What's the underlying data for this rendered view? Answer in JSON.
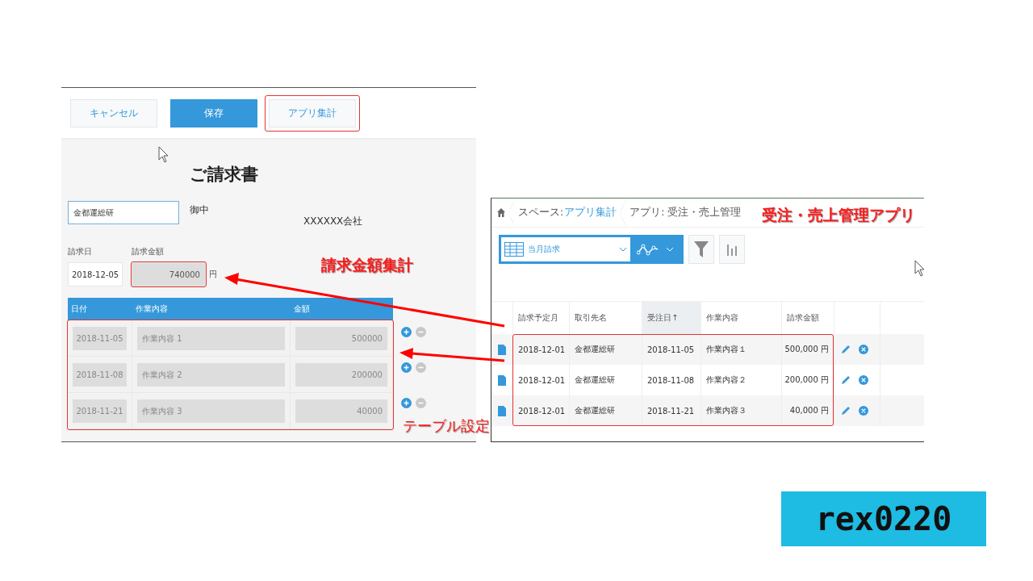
{
  "form_panel": {
    "buttons": [
      {
        "label": "キャンセル",
        "kind": "secondary",
        "highlighted": false
      },
      {
        "label": "保存",
        "kind": "primary",
        "highlighted": false
      },
      {
        "label": "アプリ集計",
        "kind": "secondary",
        "highlighted": true
      }
    ],
    "title": "ご請求書",
    "customer_field": {
      "value": "金都運総研"
    },
    "honorific": "御中",
    "company": "XXXXXX会社",
    "date_field": {
      "label": "請求日",
      "value": "2018-12-05"
    },
    "amount_field": {
      "label": "請求金額",
      "value": "740000",
      "unit": "円",
      "highlighted": true
    },
    "table": {
      "columns": [
        "日付",
        "作業内容",
        "金額"
      ],
      "highlighted": true,
      "rows": [
        [
          "2018-11-05",
          "作業内容 1",
          "500000"
        ],
        [
          "2018-11-08",
          "作業内容 2",
          "200000"
        ],
        [
          "2018-11-21",
          "作業内容 3",
          "40000"
        ]
      ]
    }
  },
  "list_panel": {
    "breadcrumb": [
      {
        "label": "スペース:",
        "link": "アプリ集計"
      },
      {
        "label": "アプリ: 受注・売上管理"
      }
    ],
    "view_select": {
      "value": "当月請求"
    },
    "table": {
      "columns": [
        {
          "label": "請求予定月",
          "sorted": false
        },
        {
          "label": "取引先名",
          "sorted": false
        },
        {
          "label": "受注日↑",
          "sorted": true
        },
        {
          "label": "作業内容",
          "sorted": false
        },
        {
          "label": "請求金額",
          "sorted": false
        }
      ],
      "highlighted": true,
      "rows": [
        [
          "2018-12-01",
          "金都運総研",
          "2018-11-05",
          "作業内容１",
          "500,000 円"
        ],
        [
          "2018-12-01",
          "金都運総研",
          "2018-11-08",
          "作業内容２",
          "200,000 円"
        ],
        [
          "2018-12-01",
          "金都運総研",
          "2018-11-21",
          "作業内容３",
          "40,000 円"
        ]
      ]
    }
  },
  "annotations": [
    {
      "text": "請求金額集計",
      "kind": "amount"
    },
    {
      "text": "テーブル設定",
      "kind": "table"
    },
    {
      "text": "受注・売上管理アプリ",
      "kind": "app"
    }
  ],
  "logo": "rex0220"
}
